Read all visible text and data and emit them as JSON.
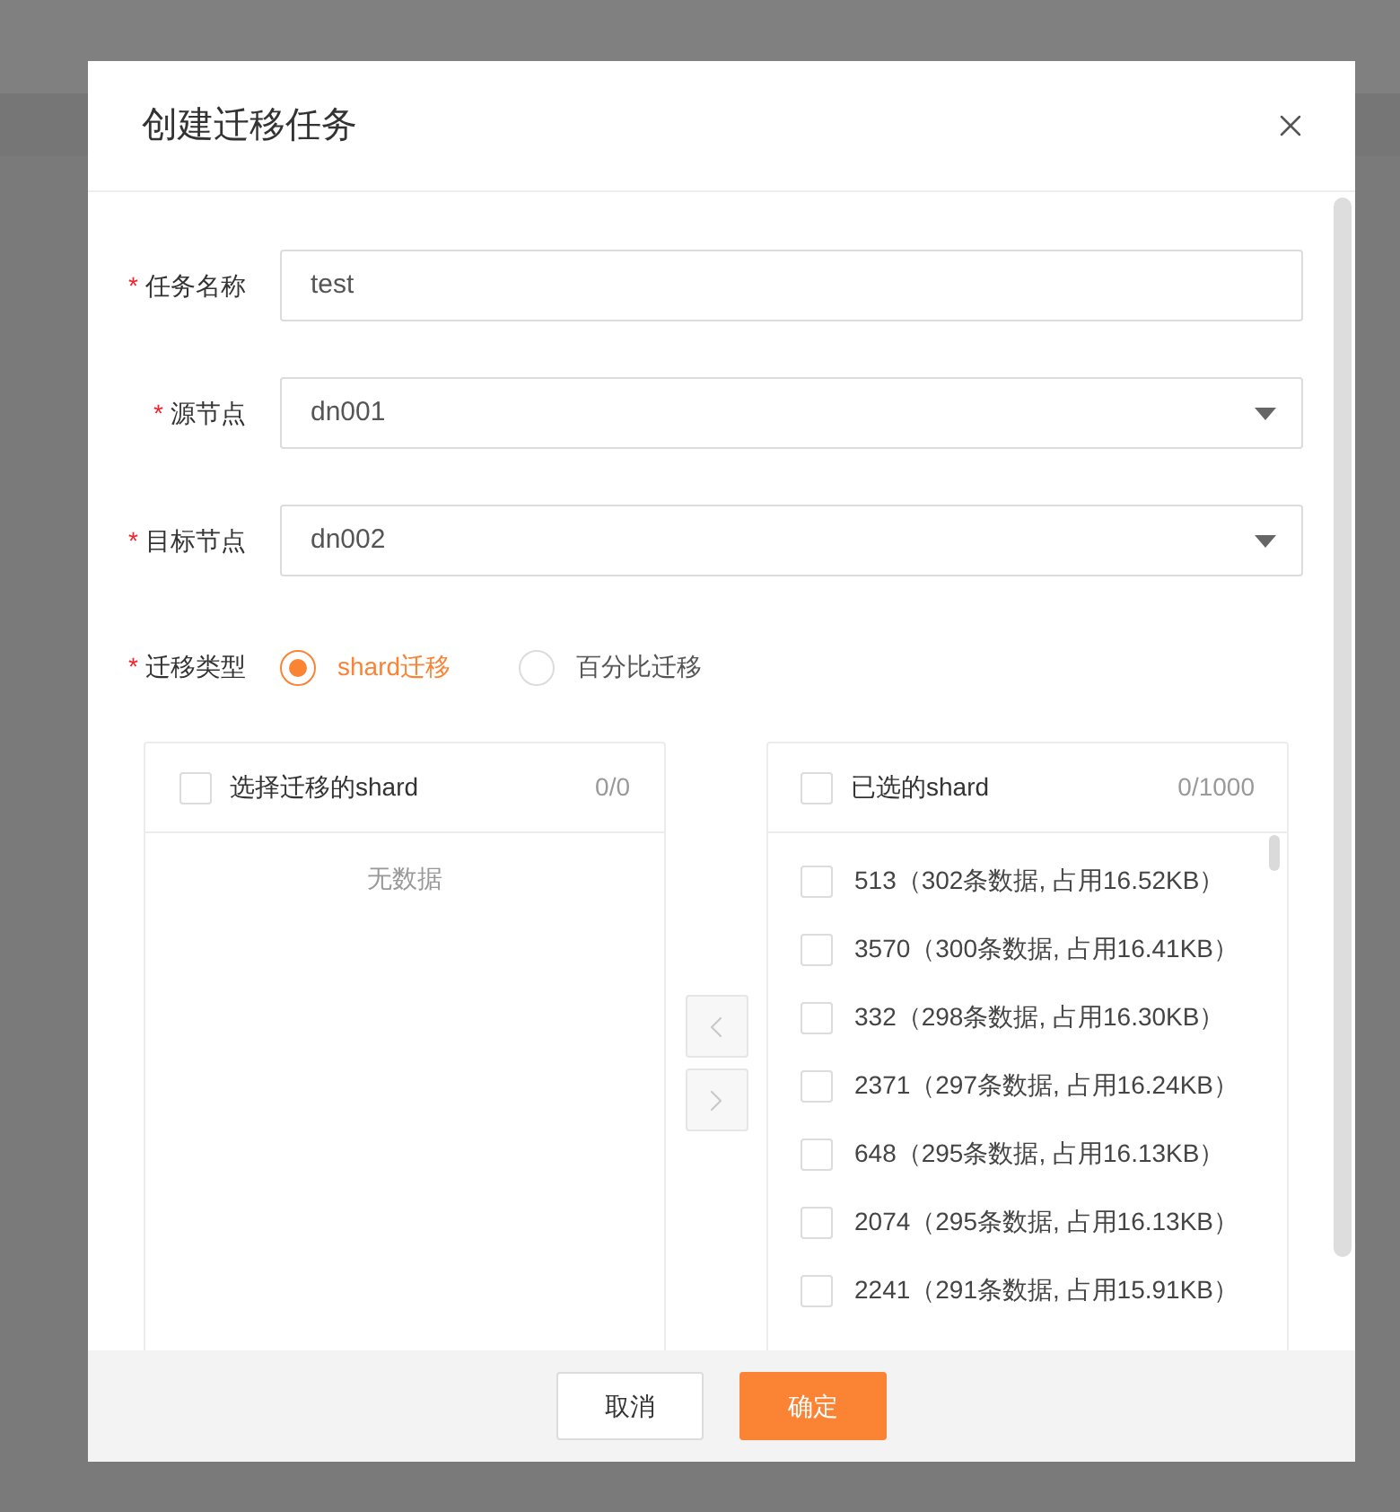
{
  "dialog": {
    "title": "创建迁移任务"
  },
  "fields": [
    {
      "kind": "input",
      "label": "任务名称",
      "required_mark": "*",
      "value": "test"
    },
    {
      "kind": "select",
      "label": "源节点",
      "required_mark": "*",
      "value": "dn001"
    },
    {
      "kind": "select",
      "label": "目标节点",
      "required_mark": "*",
      "value": "dn002"
    }
  ],
  "migration_type": {
    "label": "迁移类型",
    "required_mark": "*",
    "options": [
      {
        "label": "shard迁移",
        "selected": true
      },
      {
        "label": "百分比迁移",
        "selected": false
      }
    ]
  },
  "transfer": {
    "left": {
      "title": "选择迁移的shard",
      "count": "0/0",
      "checked": false,
      "empty_text": "无数据"
    },
    "arrows": [
      {
        "kind": "left",
        "disabled": true
      },
      {
        "kind": "right",
        "disabled": true
      }
    ],
    "right": {
      "title": "已选的shard",
      "count": "0/1000",
      "checked": false,
      "items": [
        {
          "text": "513（302条数据, 占用16.52KB）",
          "checked": false
        },
        {
          "text": "3570（300条数据, 占用16.41KB）",
          "checked": false
        },
        {
          "text": "332（298条数据, 占用16.30KB）",
          "checked": false
        },
        {
          "text": "2371（297条数据, 占用16.24KB）",
          "checked": false
        },
        {
          "text": "648（295条数据, 占用16.13KB）",
          "checked": false
        },
        {
          "text": "2074（295条数据, 占用16.13KB）",
          "checked": false
        },
        {
          "text": "2241（291条数据, 占用15.91KB）",
          "checked": false
        }
      ]
    }
  },
  "buttons": [
    {
      "kind": "default",
      "label": "取消"
    },
    {
      "kind": "primary",
      "label": "确定"
    }
  ]
}
